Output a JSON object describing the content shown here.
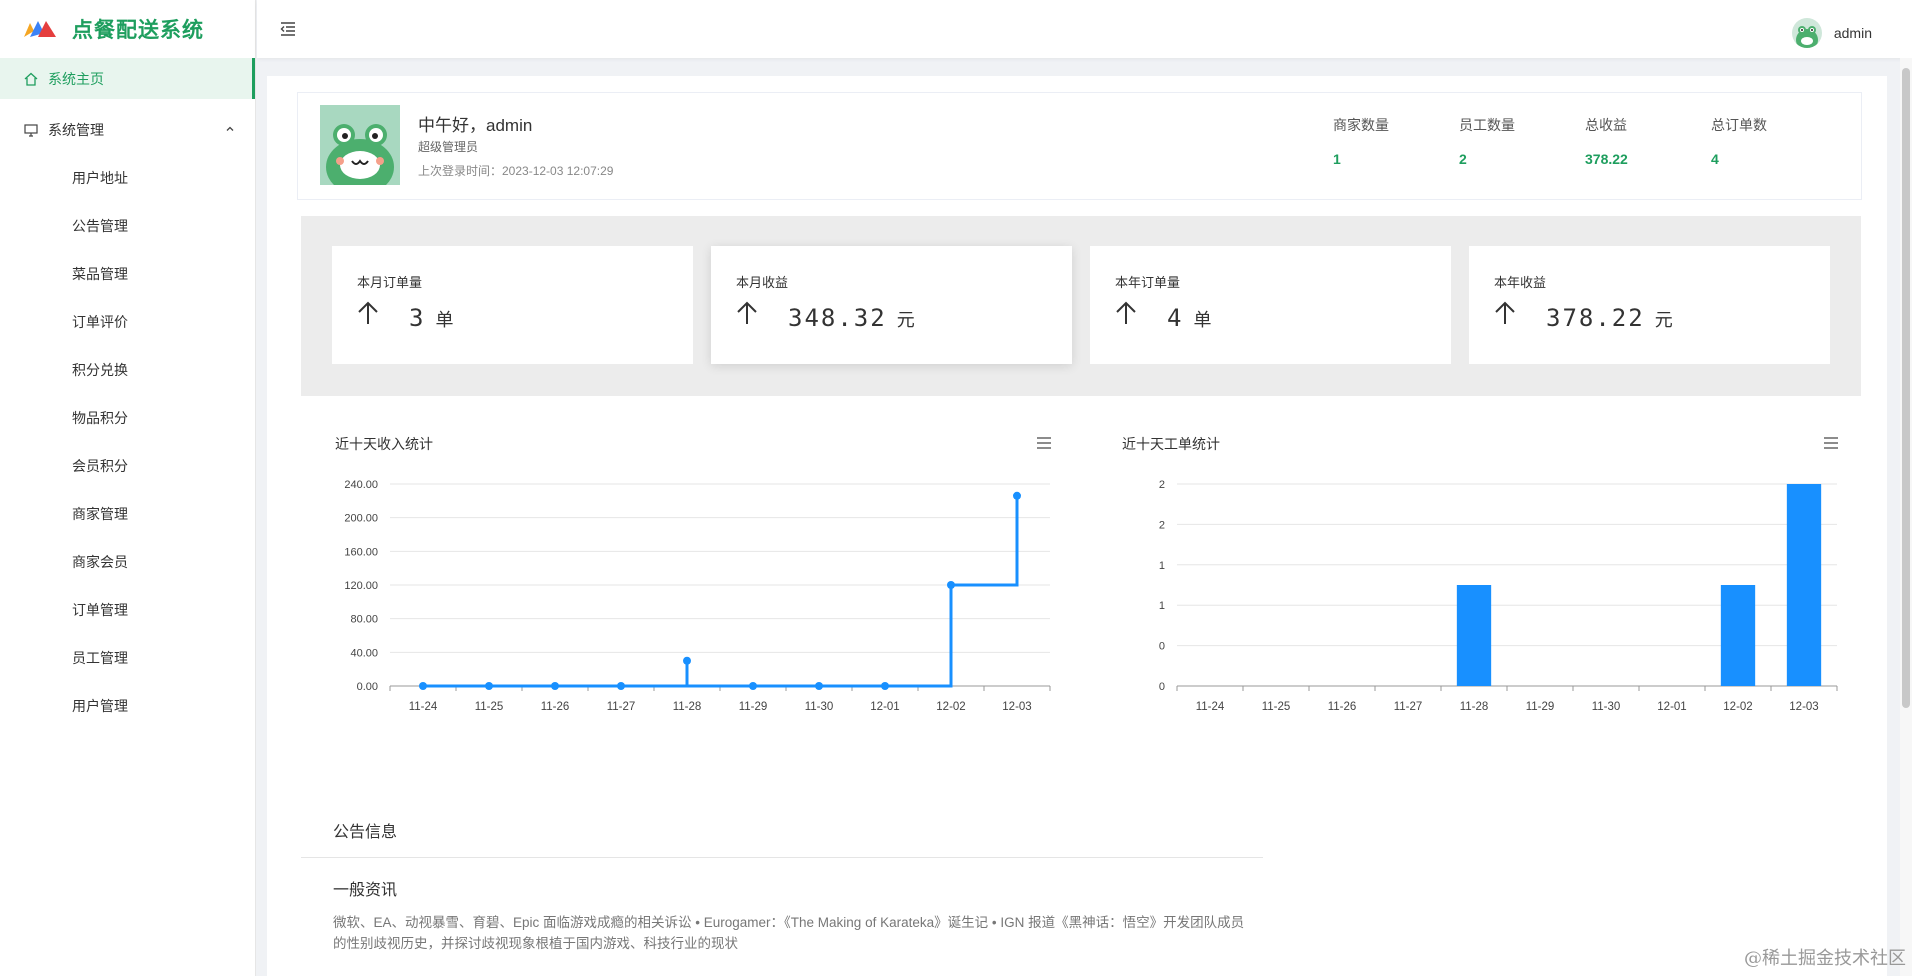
{
  "app": {
    "title": "点餐配送系统"
  },
  "sidebar": {
    "home_label": "系统主页",
    "group_label": "系统管理",
    "items": [
      {
        "label": "用户地址"
      },
      {
        "label": "公告管理"
      },
      {
        "label": "菜品管理"
      },
      {
        "label": "订单评价"
      },
      {
        "label": "积分兑换"
      },
      {
        "label": "物品积分"
      },
      {
        "label": "会员积分"
      },
      {
        "label": "商家管理"
      },
      {
        "label": "商家会员"
      },
      {
        "label": "订单管理"
      },
      {
        "label": "员工管理"
      },
      {
        "label": "用户管理"
      }
    ]
  },
  "header": {
    "username": "admin"
  },
  "profile": {
    "greeting": "中午好，admin",
    "role": "超级管理员",
    "last_login": "上次登录时间：2023-12-03 12:07:29",
    "stats": [
      {
        "label": "商家数量",
        "value": "1"
      },
      {
        "label": "员工数量",
        "value": "2"
      },
      {
        "label": "总收益",
        "value": "378.22"
      },
      {
        "label": "总订单数",
        "value": "4"
      }
    ]
  },
  "cards": [
    {
      "title": "本月订单量",
      "value": "3",
      "unit": "单"
    },
    {
      "title": "本月收益",
      "value": "348.32",
      "unit": "元"
    },
    {
      "title": "本年订单量",
      "value": "4",
      "unit": "单"
    },
    {
      "title": "本年收益",
      "value": "378.22",
      "unit": "元"
    }
  ],
  "chart_data": [
    {
      "type": "line",
      "title": "近十天收入统计",
      "step": true,
      "categories": [
        "11-24",
        "11-25",
        "11-26",
        "11-27",
        "11-28",
        "11-29",
        "11-30",
        "12-01",
        "12-02",
        "12-03"
      ],
      "values": [
        0,
        0,
        0,
        0,
        30,
        0,
        0,
        0,
        120,
        226
      ],
      "ylim": [
        0,
        240
      ],
      "yticks": [
        "0.00",
        "40.00",
        "80.00",
        "120.00",
        "160.00",
        "200.00",
        "240.00"
      ],
      "grid": true,
      "color": "#1890ff"
    },
    {
      "type": "bar",
      "title": "近十天工单统计",
      "categories": [
        "11-24",
        "11-25",
        "11-26",
        "11-27",
        "11-28",
        "11-29",
        "11-30",
        "12-01",
        "12-02",
        "12-03"
      ],
      "values": [
        0,
        0,
        0,
        0,
        1,
        0,
        0,
        0,
        1,
        2
      ],
      "ylim": [
        0,
        2
      ],
      "yticks": [
        "0",
        "0",
        "1",
        "1",
        "2",
        "2"
      ],
      "grid": true,
      "color": "#1890ff"
    }
  ],
  "notice": {
    "title": "公告信息",
    "subtitle": "一般资讯",
    "body": "微软、EA、动视暴雪、育碧、Epic 面临游戏成瘾的相关诉讼 • Eurogamer：《The Making of Karateka》诞生记 • IGN 报道《黑神话：悟空》开发团队成员的性别歧视历史，并探讨歧视现象根植于国内游戏、科技行业的现状"
  },
  "watermark": "@稀土掘金技术社区"
}
